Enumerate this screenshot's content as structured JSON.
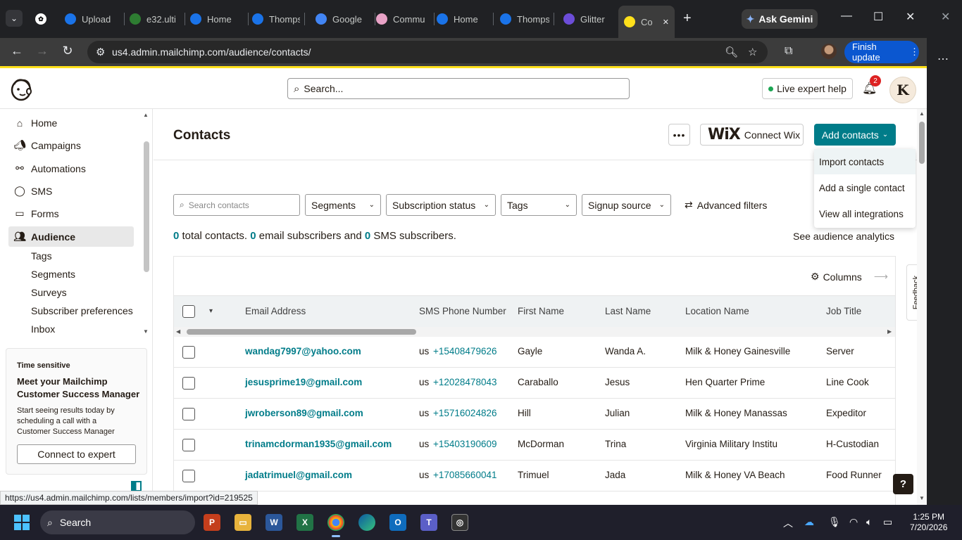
{
  "browser": {
    "tabs": [
      {
        "label": "Upload",
        "icon": "c-icon",
        "color": "#1a73e8"
      },
      {
        "label": "e32.ulti",
        "icon": "ukg-icon",
        "color": "#2e7d32"
      },
      {
        "label": "Home",
        "icon": "c-icon",
        "color": "#1a73e8"
      },
      {
        "label": "Thomps",
        "icon": "c-icon",
        "color": "#1a73e8"
      },
      {
        "label": "Google",
        "icon": "calendar-icon",
        "color": "#4285f4"
      },
      {
        "label": "Commu",
        "icon": "community-icon",
        "color": "#e8a2c6"
      },
      {
        "label": "Home",
        "icon": "c-icon",
        "color": "#1a73e8"
      },
      {
        "label": "Thomps",
        "icon": "c-icon",
        "color": "#1a73e8"
      },
      {
        "label": "Glitter",
        "icon": "g-icon",
        "color": "#6c4dd8"
      },
      {
        "label": "Co",
        "icon": "mailchimp-icon",
        "color": "#ffe01b"
      }
    ],
    "ask_gemini": "Ask Gemini",
    "url": "us4.admin.mailchimp.com/audience/contacts/",
    "finish_update": "Finish update",
    "status_url": "https://us4.admin.mailchimp.com/lists/members/import?id=219525"
  },
  "header": {
    "search_placeholder": "Search...",
    "live_help": "Live expert help",
    "notif_count": "2",
    "user_initial": "K"
  },
  "sidebar": {
    "items": [
      {
        "label": "Home",
        "icon": "home-icon"
      },
      {
        "label": "Campaigns",
        "icon": "megaphone-icon"
      },
      {
        "label": "Automations",
        "icon": "automations-icon"
      },
      {
        "label": "SMS",
        "icon": "sms-icon"
      },
      {
        "label": "Forms",
        "icon": "forms-icon"
      },
      {
        "label": "Audience",
        "icon": "audience-icon"
      }
    ],
    "subitems": [
      "Tags",
      "Segments",
      "Surveys",
      "Subscriber preferences",
      "Inbox"
    ],
    "promo": {
      "tag": "Time sensitive",
      "title": "Meet your Mailchimp Customer Success Manager",
      "desc": "Start seeing results today by scheduling a call with a Customer Success Manager",
      "cta": "Connect to expert"
    }
  },
  "main": {
    "title": "Contacts",
    "wix_logo": "WiX",
    "connect_wix": "Connect Wix",
    "add_contacts": "Add contacts",
    "menu": [
      "Import contacts",
      "Add a single contact",
      "View all integrations"
    ],
    "search_contacts": "Search contacts",
    "filters": [
      "Segments",
      "Subscription status",
      "Tags",
      "Signup source"
    ],
    "advanced_filters": "Advanced filters",
    "summary": {
      "total": "0",
      "total_text": "total contacts.",
      "email": "0",
      "email_text": "email subscribers and",
      "sms": "0",
      "sms_text": "SMS subscribers."
    },
    "see_analytics": "See audience analytics",
    "feedback": "Feedback",
    "columns": "Columns",
    "table_headers": [
      "Email Address",
      "SMS Phone Number",
      "First Name",
      "Last Name",
      "Location Name",
      "Job Title"
    ],
    "rows": [
      {
        "email": "wandag7997@yahoo.com",
        "cc": "us",
        "phone": "+15408479626",
        "first": "Gayle",
        "last": "Wanda A.",
        "location": "Milk & Honey Gainesville",
        "job": "Server"
      },
      {
        "email": "jesusprime19@gmail.com",
        "cc": "us",
        "phone": "+12028478043",
        "first": "Caraballo",
        "last": "Jesus",
        "location": "Hen Quarter Prime",
        "job": "Line Cook"
      },
      {
        "email": "jwroberson89@gmail.com",
        "cc": "us",
        "phone": "+15716024826",
        "first": "Hill",
        "last": "Julian",
        "location": "Milk & Honey Manassas",
        "job": "Expeditor"
      },
      {
        "email": "trinamcdorman1935@gmail.com",
        "cc": "us",
        "phone": "+15403190609",
        "first": "McDorman",
        "last": "Trina",
        "location": "Virginia Military Institu",
        "job": "H-Custodian"
      },
      {
        "email": "jadatrimuel@gmail.com",
        "cc": "us",
        "phone": "+17085660041",
        "first": "Trimuel",
        "last": "Jada",
        "location": "Milk & Honey VA Beach",
        "job": "Food Runner"
      }
    ],
    "help": "?"
  },
  "taskbar": {
    "search": "Search",
    "time": "1:25 PM",
    "date": "7/20/2026"
  }
}
